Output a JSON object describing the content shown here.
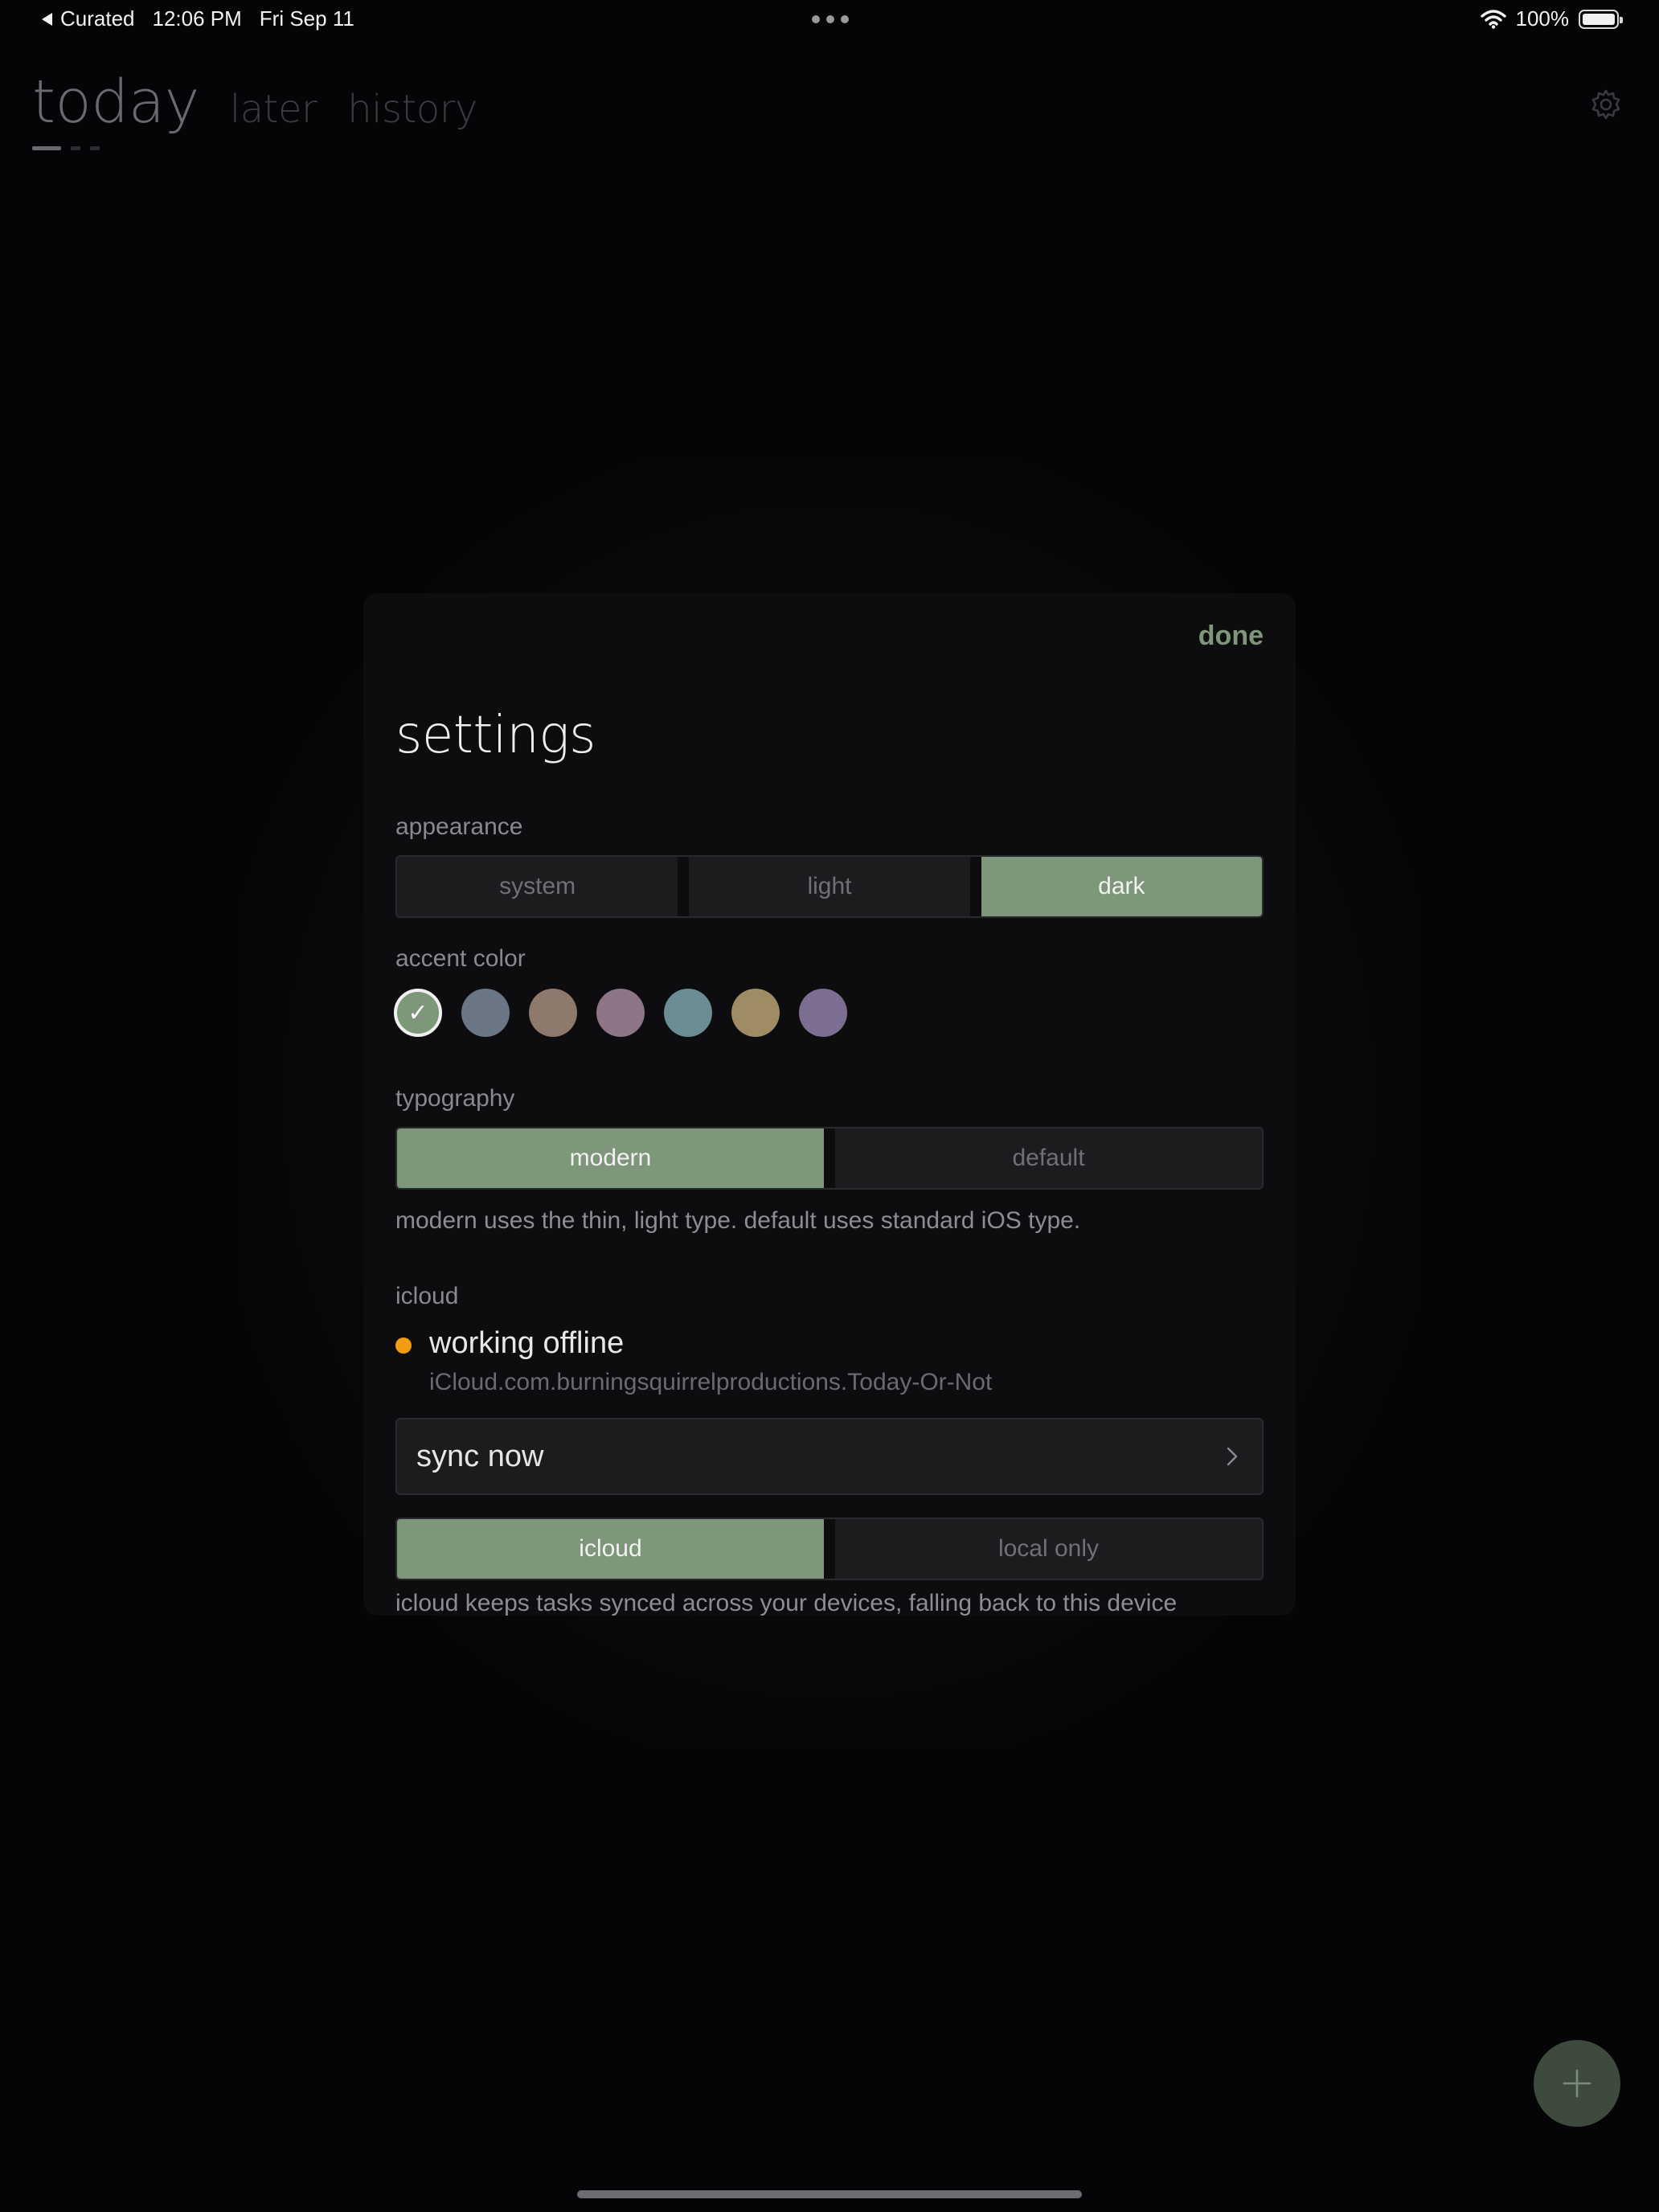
{
  "status_bar": {
    "back_app": "Curated",
    "time": "12:06 PM",
    "date": "Fri Sep 11",
    "battery": "100%"
  },
  "nav": {
    "tabs": [
      "today",
      "later",
      "history"
    ],
    "active": "today"
  },
  "modal": {
    "done_label": "done",
    "title": "settings",
    "appearance": {
      "label": "appearance",
      "options": [
        "system",
        "light",
        "dark"
      ],
      "selected": "dark"
    },
    "accent": {
      "label": "accent color",
      "colors": [
        "#7e977a",
        "#6a7684",
        "#8e7a6c",
        "#8c7686",
        "#6a8c92",
        "#a08c64",
        "#7c6e90"
      ],
      "selected_index": 0,
      "check": "✓"
    },
    "typography": {
      "label": "typography",
      "options": [
        "modern",
        "default"
      ],
      "selected": "modern",
      "hint": "modern uses the thin, light type. default uses standard iOS type."
    },
    "icloud": {
      "label": "icloud",
      "status": "working offline",
      "container": "iCloud.com.burningsquirrelproductions.Today-Or-Not",
      "status_color": "#f39c12",
      "sync_label": "sync now",
      "options": [
        "icloud",
        "local only"
      ],
      "selected": "icloud",
      "hint": "icloud keeps tasks synced across your devices, falling back to this device"
    }
  },
  "colors": {
    "accent": "#7e977a",
    "background": "#050507",
    "modal": "#0d0d10"
  },
  "fab": {
    "icon": "plus-icon"
  }
}
